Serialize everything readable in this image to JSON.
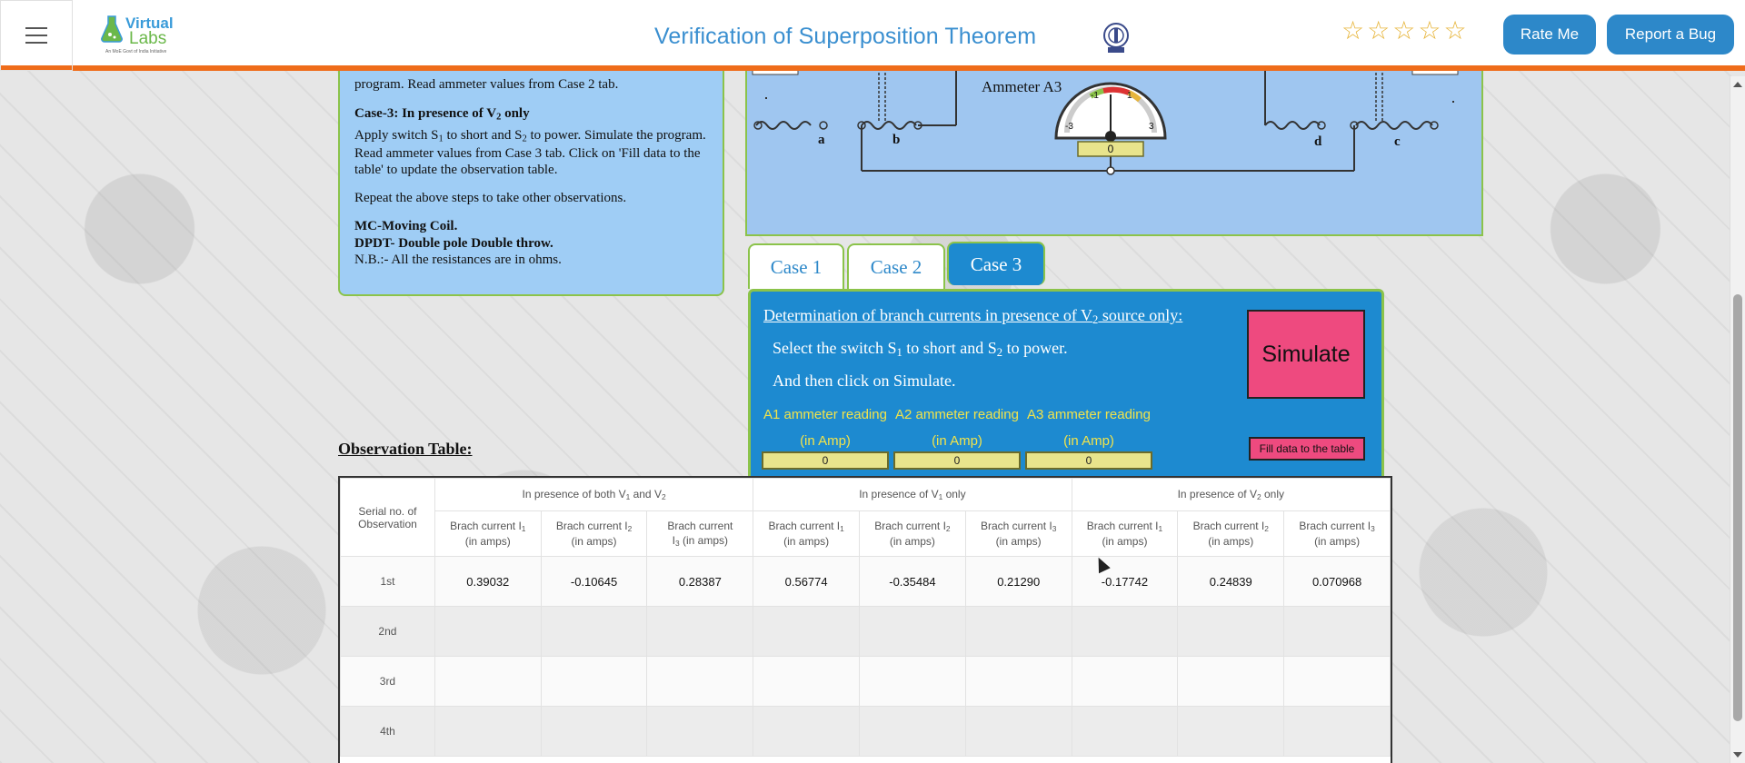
{
  "header": {
    "title": "Verification of Superposition Theorem",
    "logo_word1": "Virtual",
    "logo_word2": "Labs",
    "logo_sub": "An MoE Govt of India Initiative",
    "stars": [
      "☆",
      "☆",
      "☆",
      "☆",
      "☆"
    ],
    "rate_label": "Rate Me",
    "bug_label": "Report a Bug"
  },
  "instructions": {
    "top_line": "program. Read ammeter values from Case 2 tab.",
    "case3_title": "Case-3: In presence of V",
    "case3_sub": "2",
    "case3_title_end": " only",
    "case3_p1": "Apply switch S",
    "case3_p1_s1": "1",
    "case3_p1_b": " to short and S",
    "case3_p1_s2": "2",
    "case3_p1_c": " to power. Simulate the program. Read ammeter values from Case 3 tab. Click on 'Fill data to the table' to update the observation table.",
    "repeat": "Repeat the above steps to take other observations.",
    "mc": "MC-Moving Coil.",
    "dpdt": "DPDT- Double pole Double throw.",
    "nb": "N.B.:- All the resistances are in ohms."
  },
  "circuit": {
    "ammeter_label": "Ammeter A3",
    "ammeter_value": "0",
    "scale": [
      "-3",
      "-1",
      "1",
      "3"
    ],
    "nodes": [
      "a",
      "b",
      "d",
      "c"
    ]
  },
  "tabs": [
    "Case 1",
    "Case 2",
    "Case 3"
  ],
  "case3": {
    "heading_a": "Determination of branch currents in presence of V",
    "heading_sub": "2",
    "heading_b": " source only:",
    "line1_a": "Select the switch S",
    "line1_s1": "1",
    "line1_b": " to short and S",
    "line1_s2": "2",
    "line1_c": " to power.",
    "line2": "And then click on Simulate.",
    "readings": [
      {
        "label": "A1 ammeter reading",
        "unit": "(in Amp)",
        "value": "0"
      },
      {
        "label": "A2 ammeter reading",
        "unit": "(in Amp)",
        "value": "0"
      },
      {
        "label": "A3 ammeter reading",
        "unit": "(in Amp)",
        "value": "0"
      }
    ],
    "simulate_label": "Simulate",
    "fill_label": "Fill data to the table"
  },
  "observation": {
    "title": "Observation Table:",
    "serial_header": "Serial no. of Observation",
    "groups": [
      "In presence of both V1 and V2",
      "In presence of V1 only",
      "In presence of V2 only"
    ],
    "sub_headers": [
      "Brach current I1 (in amps)",
      "Brach current I2 (in amps)",
      "Brach current I3 (in amps)"
    ],
    "rows": [
      {
        "serial": "1st",
        "values": [
          "0.39032",
          "-0.10645",
          "0.28387",
          "0.56774",
          "-0.35484",
          "0.21290",
          "-0.17742",
          "0.24839",
          "0.070968"
        ]
      },
      {
        "serial": "2nd",
        "values": [
          "",
          "",
          "",
          "",
          "",
          "",
          "",
          "",
          ""
        ]
      },
      {
        "serial": "3rd",
        "values": [
          "",
          "",
          "",
          "",
          "",
          "",
          "",
          "",
          ""
        ]
      },
      {
        "serial": "4th",
        "values": [
          "",
          "",
          "",
          "",
          "",
          "",
          "",
          "",
          ""
        ]
      }
    ]
  },
  "colors": {
    "header_accent": "#ef6c1a",
    "title_blue": "#3a8fd0",
    "button_blue": "#2d88c9",
    "panel_blue": "#1d8ad0",
    "light_blue": "#9fcdf5",
    "green_border": "#8bc34a",
    "pink": "#ee4a7f",
    "star_gold": "#e7b53b"
  }
}
